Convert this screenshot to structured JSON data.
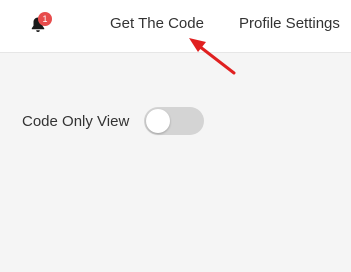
{
  "topbar": {
    "notifications": {
      "icon": "bell-icon",
      "count": "1",
      "badge_color": "#e74c4c"
    },
    "nav": {
      "get_code": "Get The Code",
      "profile_settings": "Profile Settings"
    }
  },
  "annotation": {
    "icon": "arrow-icon",
    "color": "#e02020"
  },
  "settings": {
    "code_only_view": {
      "label": "Code Only View",
      "enabled": false
    }
  }
}
